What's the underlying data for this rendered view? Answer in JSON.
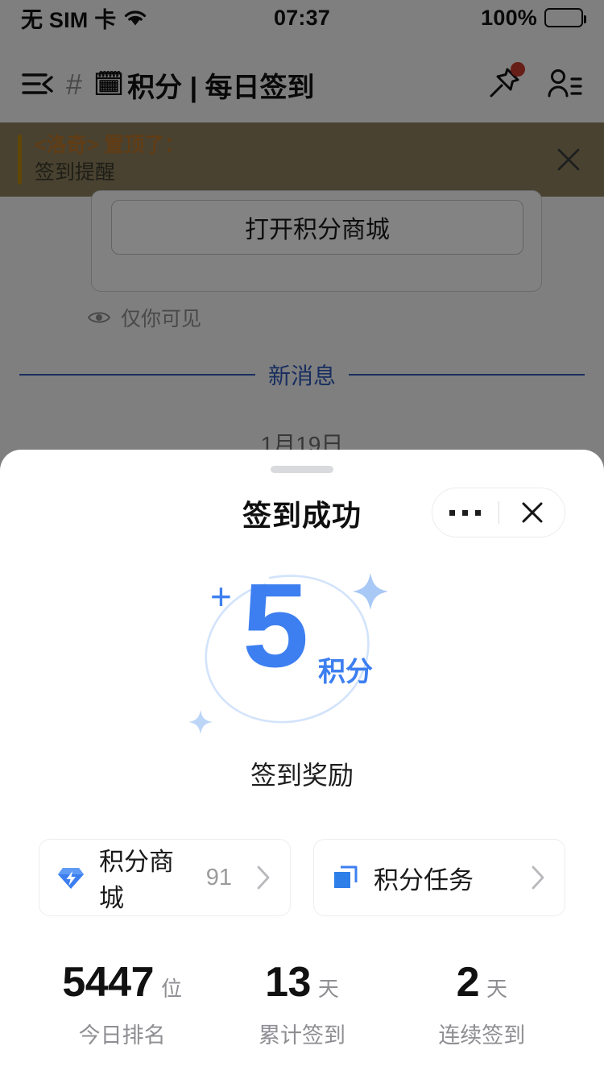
{
  "status_bar": {
    "carrier": "无 SIM 卡",
    "wifi_icon": "wifi-icon",
    "time": "07:37",
    "battery_percent": "100%",
    "battery_icon": "battery-full-icon"
  },
  "chat_header": {
    "menu_icon": "menu-back-icon",
    "hash_icon": "hash-channel-icon",
    "calendar_emoji": "🗓",
    "title": "积分 | 每日签到",
    "pin_icon": "pin-icon",
    "pin_badge": "notification-dot",
    "members_icon": "member-list-icon"
  },
  "pinned_banner": {
    "author_line": "<洛奇> 置顶了：",
    "content": "签到提醒",
    "close_icon": "close-icon",
    "accent_color": "#b8860b",
    "background_color": "#8a7d5e",
    "title_color": "#b5732a"
  },
  "chat_body": {
    "open_shop_button": "打开积分商城",
    "visibility_icon": "eye-icon",
    "visibility_note": "仅你可见",
    "new_message_divider": "新消息",
    "new_message_color": "#2f57b5",
    "date_label": "1月19日"
  },
  "sheet": {
    "drag_handle": "drag-handle",
    "title": "签到成功",
    "more_icon": "more-dots-icon",
    "close_icon": "close-icon",
    "hero": {
      "plus": "+",
      "amount": "5",
      "unit": "积分",
      "accent_color": "#3d7ff0",
      "arc_color": "#d3e3fb",
      "sparkle_color": "#a8c8f5",
      "sparkle_icon": "sparkle-star-icon"
    },
    "reward_caption": "签到奖励",
    "cards": [
      {
        "icon": "points-gem-icon",
        "label": "积分商城",
        "value": "91",
        "chevron_icon": "chevron-right-icon"
      },
      {
        "icon": "task-layers-icon",
        "label": "积分任务",
        "value": "",
        "chevron_icon": "chevron-right-icon"
      }
    ],
    "stats": [
      {
        "value": "5447",
        "unit": "位",
        "label": "今日排名"
      },
      {
        "value": "13",
        "unit": "天",
        "label": "累计签到"
      },
      {
        "value": "2",
        "unit": "天",
        "label": "连续签到"
      }
    ]
  }
}
